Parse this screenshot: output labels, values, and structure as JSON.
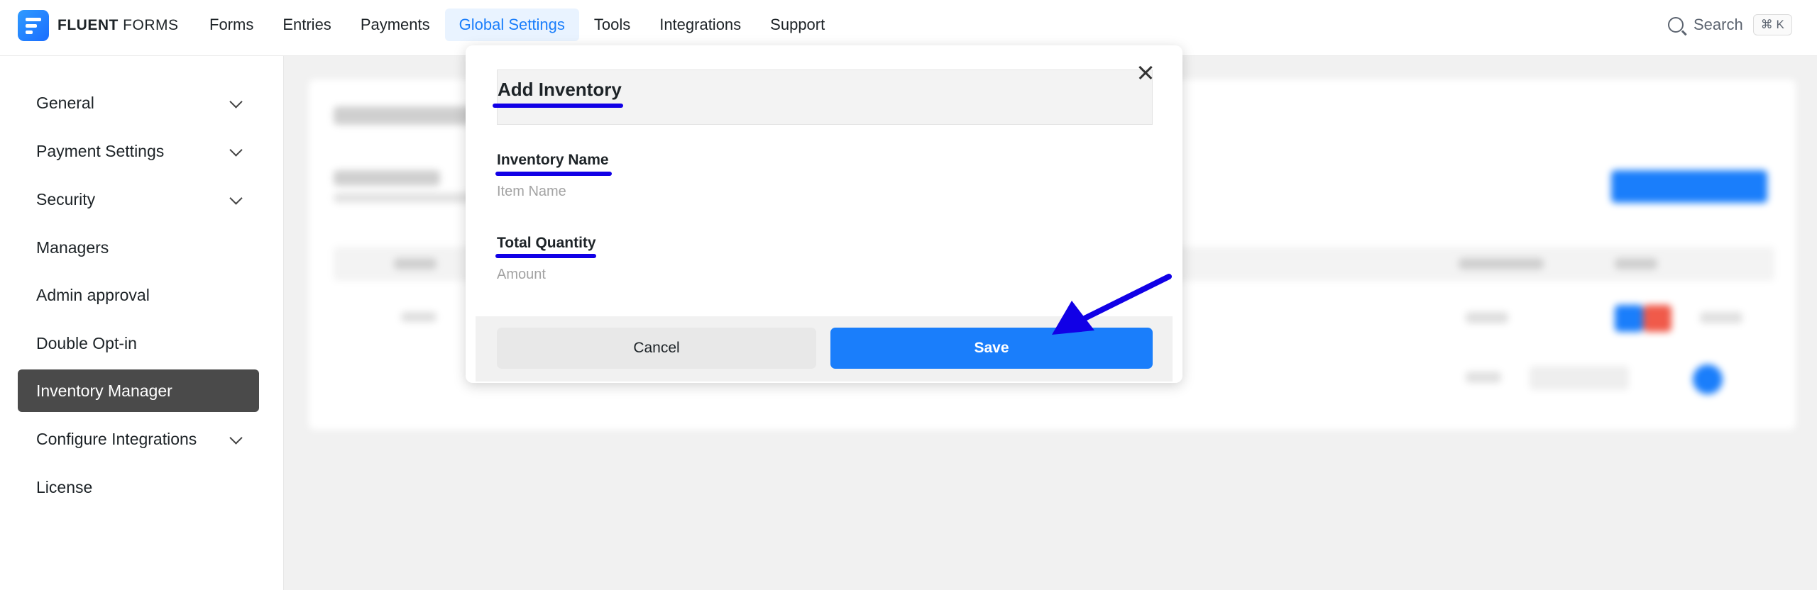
{
  "brand": {
    "name_bold": "FLUENT",
    "name_light": " FORMS"
  },
  "nav": {
    "items": [
      {
        "label": "Forms"
      },
      {
        "label": "Entries"
      },
      {
        "label": "Payments"
      },
      {
        "label": "Global Settings",
        "active": true
      },
      {
        "label": "Tools"
      },
      {
        "label": "Integrations"
      },
      {
        "label": "Support"
      }
    ],
    "search_label": "Search",
    "search_shortcut": "⌘ K"
  },
  "sidebar": {
    "items": [
      {
        "label": "General",
        "expandable": true
      },
      {
        "label": "Payment Settings",
        "expandable": true
      },
      {
        "label": "Security",
        "expandable": true
      },
      {
        "label": "Managers",
        "expandable": false
      },
      {
        "label": "Admin approval",
        "expandable": false
      },
      {
        "label": "Double Opt-in",
        "expandable": false
      },
      {
        "label": "Inventory Manager",
        "expandable": false,
        "active": true
      },
      {
        "label": "Configure Integrations",
        "expandable": true
      },
      {
        "label": "License",
        "expandable": false
      }
    ]
  },
  "modal": {
    "title": "Add Inventory",
    "fields": {
      "name": {
        "label": "Inventory Name",
        "placeholder": "Item Name",
        "value": ""
      },
      "quantity": {
        "label": "Total Quantity",
        "placeholder": "Amount",
        "value": ""
      }
    },
    "cancel_label": "Cancel",
    "save_label": "Save"
  },
  "colors": {
    "accent": "#1a7efb",
    "annotation": "#1100e6",
    "sidebar_active_bg": "#4a4a4a"
  }
}
